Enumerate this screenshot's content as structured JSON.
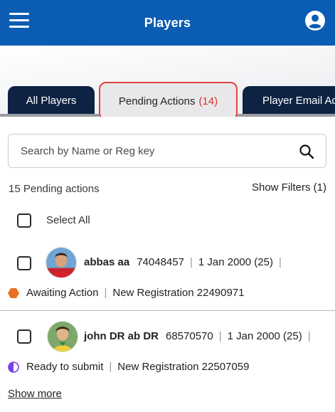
{
  "header": {
    "title": "Players",
    "menu_icon": "hamburger-menu-icon",
    "account_icon": "account-circle-icon",
    "color": "#0b5cb3"
  },
  "tabs": [
    {
      "label": "All Players",
      "active": false
    },
    {
      "label": "Pending Actions",
      "count": "(14)",
      "active": true
    },
    {
      "label": "Player Email Add",
      "active": false
    }
  ],
  "search": {
    "placeholder": "Search by Name or Reg key",
    "icon": "search-icon"
  },
  "summary": {
    "pending_count_text": "15 Pending actions",
    "show_filters_label": "Show Filters (1)"
  },
  "select_all": {
    "label": "Select All",
    "checked": false
  },
  "players": [
    {
      "name": "abbas aa",
      "reg_key": "74048457",
      "dob": "1 Jan 2000 (25)",
      "status": "Awaiting Action",
      "status_color": "#e8701e",
      "status_icon": "hexagon-icon",
      "action": "New Registration 22490971",
      "checked": false
    },
    {
      "name": "john DR ab DR",
      "reg_key": "68570570",
      "dob": "1 Jan 2000 (25)",
      "status": "Ready to submit",
      "status_color": "#7b3fe4",
      "status_icon": "half-circle-icon",
      "action": "New Registration 22507059",
      "checked": false
    }
  ],
  "footer": {
    "show_more_label": "Show more"
  }
}
